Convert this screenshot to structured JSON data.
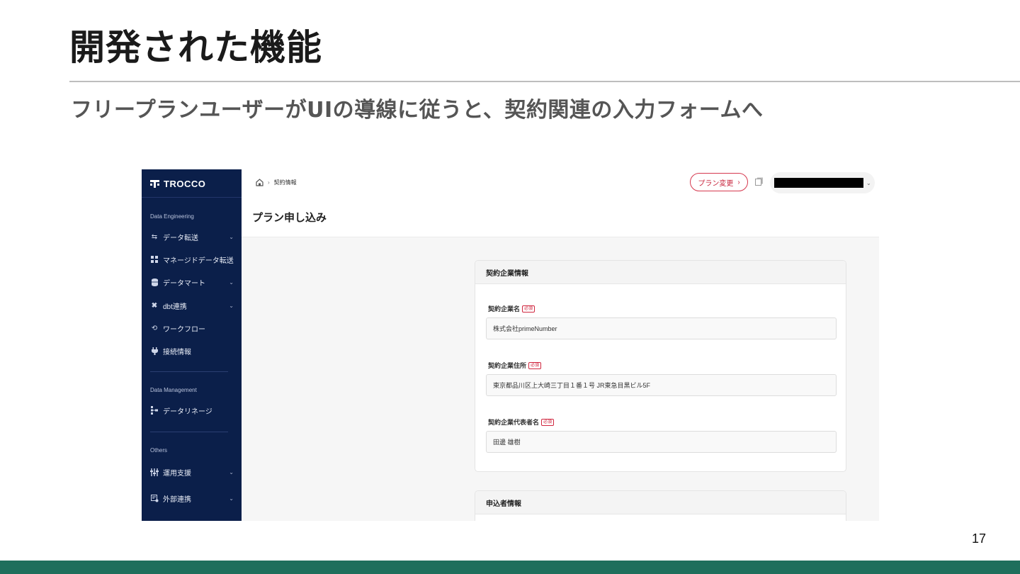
{
  "slide": {
    "title": "開発された機能",
    "subtitle": "フリープランユーザーがUIの導線に従うと、契約関連の入力フォームへ",
    "page_number": "17",
    "footer_color": "#1e6f5c"
  },
  "app": {
    "logo_text": "TROCCO",
    "sidebar": {
      "background": "#0b1f4a",
      "sections": [
        {
          "heading": "Data Engineering",
          "items": [
            {
              "label": "データ転送",
              "icon": "transfer-icon",
              "expandable": true
            },
            {
              "label": "マネージドデータ転送",
              "icon": "grid-icon",
              "expandable": false
            },
            {
              "label": "データマート",
              "icon": "database-icon",
              "expandable": true
            },
            {
              "label": "dbt連携",
              "icon": "dbt-icon",
              "expandable": true
            },
            {
              "label": "ワークフロー",
              "icon": "workflow-icon",
              "expandable": false
            },
            {
              "label": "接続情報",
              "icon": "plug-icon",
              "expandable": false
            }
          ]
        },
        {
          "heading": "Data Management",
          "items": [
            {
              "label": "データリネージ",
              "icon": "lineage-icon",
              "expandable": false
            }
          ]
        },
        {
          "heading": "Others",
          "items": [
            {
              "label": "運用支援",
              "icon": "sliders-icon",
              "expandable": true
            },
            {
              "label": "外部連携",
              "icon": "external-icon",
              "expandable": true
            }
          ]
        }
      ]
    },
    "topbar": {
      "breadcrumb_current": "契約情報",
      "plan_change_label": "プラン変更",
      "plan_change_color": "#d6394f"
    },
    "page_title": "プラン申し込み",
    "cards": [
      {
        "heading": "契約企業情報",
        "fields": [
          {
            "label": "契約企業名",
            "required_badge": "必須",
            "value": "株式会社primeNumber"
          },
          {
            "label": "契約企業住所",
            "required_badge": "必須",
            "value": "東京都品川区上大崎三丁目１番１号 JR東急目黒ビル5F"
          },
          {
            "label": "契約企業代表者名",
            "required_badge": "必須",
            "value": "田邊 雄樹"
          }
        ]
      },
      {
        "heading": "申込者情報",
        "fields": []
      }
    ]
  }
}
